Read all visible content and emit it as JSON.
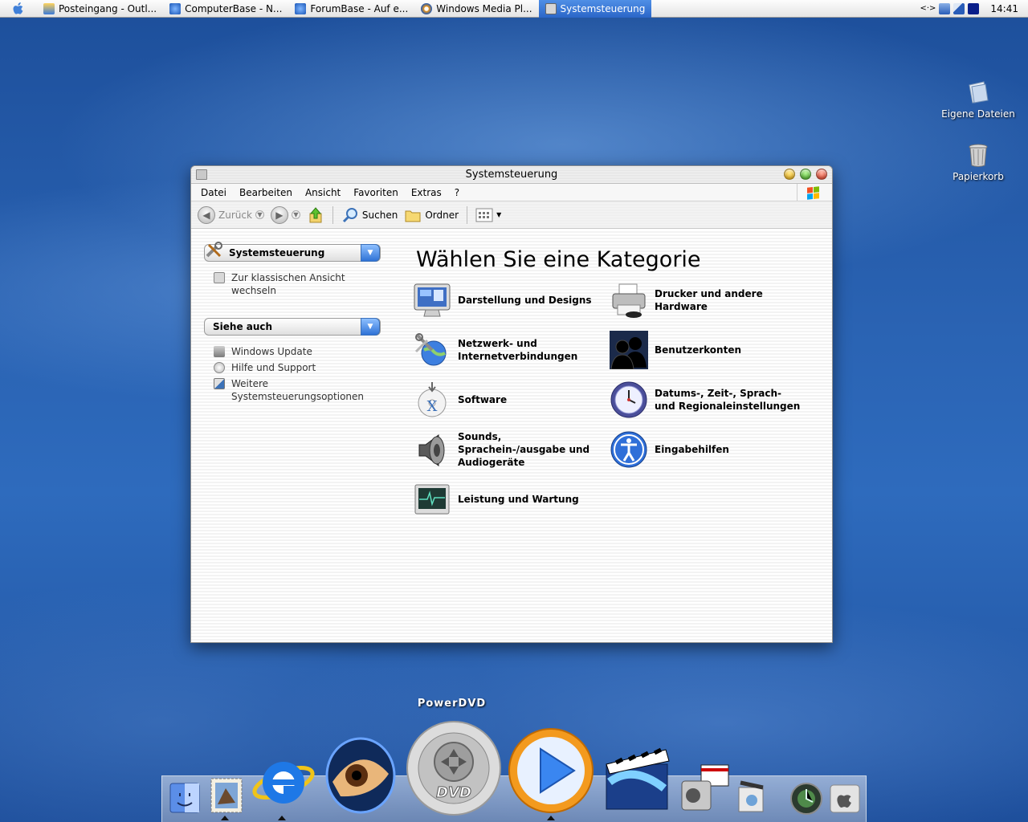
{
  "taskbar": {
    "tasks": [
      {
        "label": "Posteingang - Outl..."
      },
      {
        "label": "ComputerBase - N..."
      },
      {
        "label": "ForumBase - Auf e..."
      },
      {
        "label": "Windows Media Pl..."
      },
      {
        "label": "Systemsteuerung"
      }
    ],
    "tray_text": "<·>",
    "clock": "14:41"
  },
  "desktop": {
    "icons": [
      {
        "label": "Eigene Dateien"
      },
      {
        "label": "Papierkorb"
      }
    ]
  },
  "window": {
    "title": "Systemsteuerung",
    "menu": [
      "Datei",
      "Bearbeiten",
      "Ansicht",
      "Favoriten",
      "Extras",
      "?"
    ],
    "toolbar": {
      "back": "Zurück",
      "search": "Suchen",
      "folders": "Ordner"
    },
    "sidebar": {
      "panel1_title": "Systemsteuerung",
      "switch_link_line1": "Zur klassischen Ansicht",
      "switch_link_line2": "wechseln",
      "panel2_title": "Siehe auch",
      "links": [
        {
          "label": "Windows Update"
        },
        {
          "label": "Hilfe und Support"
        },
        {
          "line1": "Weitere",
          "line2": "Systemsteuerungsoptionen"
        }
      ]
    },
    "heading": "Wählen Sie eine Kategorie",
    "categories": [
      {
        "lines": [
          "Darstellung und Designs"
        ]
      },
      {
        "lines": [
          "Drucker und andere",
          "Hardware"
        ]
      },
      {
        "lines": [
          "Netzwerk- und",
          "Internetverbindungen"
        ]
      },
      {
        "lines": [
          "Benutzerkonten"
        ]
      },
      {
        "lines": [
          "Software"
        ]
      },
      {
        "lines": [
          "Datums-, Zeit-, Sprach-",
          "und Regionaleinstellungen"
        ]
      },
      {
        "lines": [
          "Sounds,",
          "Sprachein-/ausgabe und",
          "Audiogeräte"
        ]
      },
      {
        "lines": [
          "Eingabehilfen"
        ]
      },
      {
        "lines": [
          "Leistung und Wartung"
        ]
      }
    ]
  },
  "dock": {
    "hover_label": "PowerDVD",
    "dvd_text": "DVD"
  },
  "colors": {
    "desktop_blue": "#2a63b3",
    "active_task": "#2b66c8",
    "dock_blue": "#2f72d6"
  }
}
